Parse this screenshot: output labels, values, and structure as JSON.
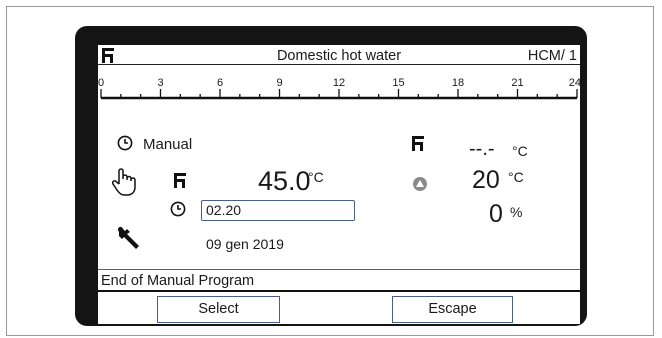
{
  "header": {
    "title": "Domestic hot water",
    "device": "HCM/ 1",
    "icon": "tap-icon"
  },
  "timeline": {
    "labels": [
      "0",
      "3",
      "6",
      "9",
      "12",
      "15",
      "18",
      "21",
      "24"
    ]
  },
  "program": {
    "mode_label": "Manual",
    "mode_icon": "clock-icon",
    "manual_icon": "hand-icon",
    "tap_icon": "tap-icon",
    "temperature_value": "45.0",
    "temperature_unit": "°C",
    "end_time_icon": "clock-icon",
    "end_time_value": "02.20",
    "date": "09 gen 2019",
    "service_icon": "wrench-icon"
  },
  "readouts": {
    "tap_icon": "tap-icon",
    "tap_temp_value": "--.-",
    "tap_temp_unit": "°C",
    "pump_icon": "pump-icon",
    "pump_temp_value": "20",
    "pump_temp_unit": "°C",
    "percent_value": "0",
    "percent_unit": "%"
  },
  "status_text": "End of Manual Program",
  "softkeys": {
    "select_label": "Select",
    "escape_label": "Escape"
  },
  "colors": {
    "bezel": "#141414",
    "accent_border": "#4a5c8c",
    "pump_icon": "#8a8a8a"
  }
}
